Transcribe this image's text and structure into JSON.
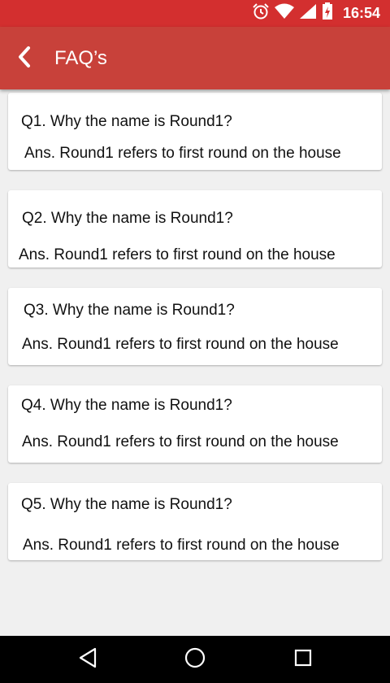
{
  "status_bar": {
    "time": "16:54"
  },
  "app_bar": {
    "title": "FAQ’s"
  },
  "faqs": [
    {
      "question": "Q1. Why the name is Round1?",
      "answer": "Ans. Round1 refers to first round on the house"
    },
    {
      "question": "Q2. Why the name is Round1?",
      "answer": "Ans. Round1 refers to first round on the house"
    },
    {
      "question": "Q3. Why the name is Round1?",
      "answer": "Ans. Round1 refers to first round on the house"
    },
    {
      "question": "Q4. Why the name is Round1?",
      "answer": "Ans. Round1 refers to first round on the house"
    },
    {
      "question": "Q5. Why the name is Round1?",
      "answer": "Ans. Round1 refers to first round on the house"
    }
  ],
  "icons": {
    "status": [
      "alarm-icon",
      "wifi-icon",
      "signal-icon",
      "battery-icon"
    ],
    "app_bar": "back-chevron-icon",
    "nav": [
      "back-triangle-icon",
      "home-circle-icon",
      "recents-square-icon"
    ]
  },
  "colors": {
    "status_bar": "#d32f2f",
    "app_bar": "#c8413a",
    "background": "#f0f0f0",
    "card": "#ffffff",
    "nav_bar": "#000000"
  }
}
